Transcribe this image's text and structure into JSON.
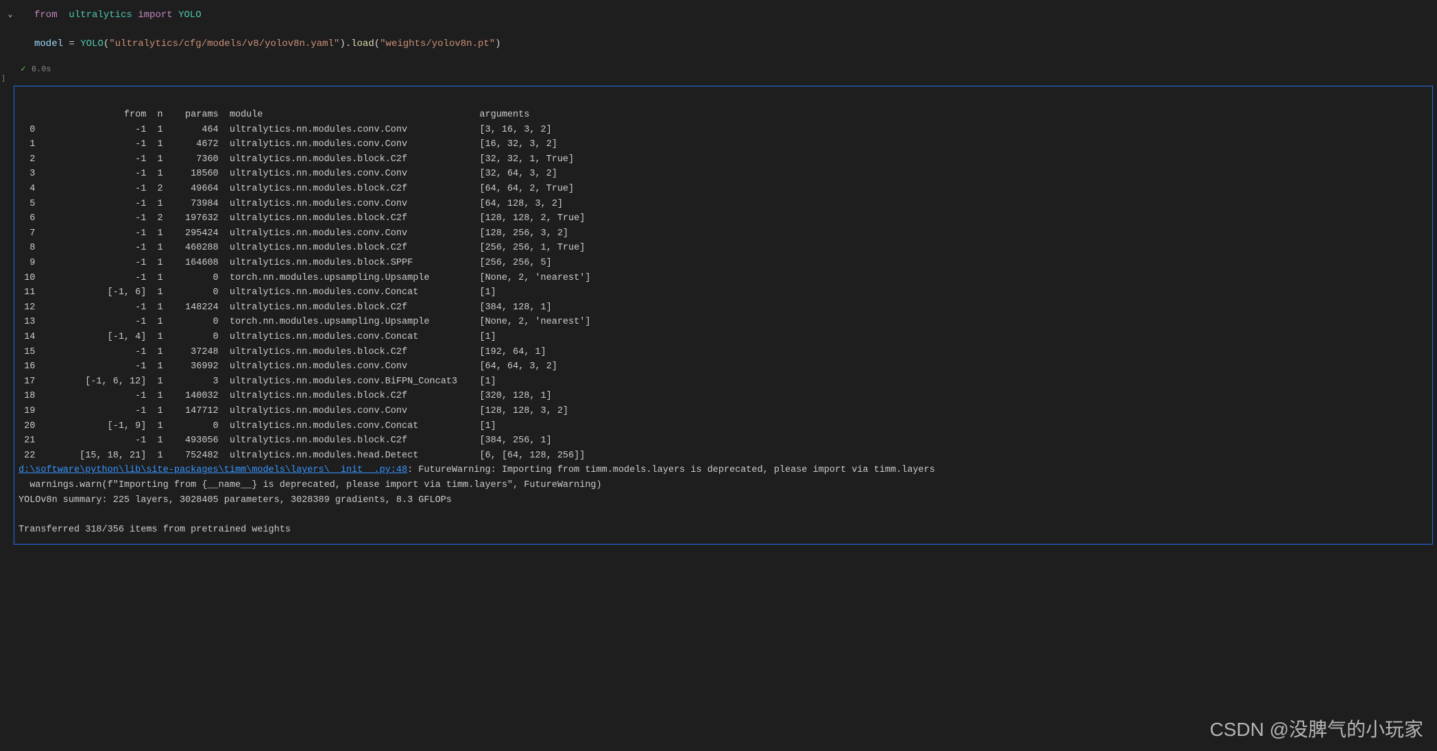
{
  "code": {
    "line1": {
      "from": "from",
      "pkg": "ultralytics",
      "import": "import",
      "cls": "YOLO"
    },
    "line2": {
      "var": "model",
      "eq": " = ",
      "cls": "YOLO",
      "arg1": "\"ultralytics/cfg/models/v8/yolov8n.yaml\"",
      "dot": ".",
      "method": "load",
      "arg2": "\"weights/yolov8n.pt\""
    }
  },
  "exec": {
    "time": "6.0s"
  },
  "cell_marker": "]",
  "output": {
    "header": "                   from  n    params  module                                       arguments",
    "rows": [
      "  0                  -1  1       464  ultralytics.nn.modules.conv.Conv             [3, 16, 3, 2]",
      "  1                  -1  1      4672  ultralytics.nn.modules.conv.Conv             [16, 32, 3, 2]",
      "  2                  -1  1      7360  ultralytics.nn.modules.block.C2f             [32, 32, 1, True]",
      "  3                  -1  1     18560  ultralytics.nn.modules.conv.Conv             [32, 64, 3, 2]",
      "  4                  -1  2     49664  ultralytics.nn.modules.block.C2f             [64, 64, 2, True]",
      "  5                  -1  1     73984  ultralytics.nn.modules.conv.Conv             [64, 128, 3, 2]",
      "  6                  -1  2    197632  ultralytics.nn.modules.block.C2f             [128, 128, 2, True]",
      "  7                  -1  1    295424  ultralytics.nn.modules.conv.Conv             [128, 256, 3, 2]",
      "  8                  -1  1    460288  ultralytics.nn.modules.block.C2f             [256, 256, 1, True]",
      "  9                  -1  1    164608  ultralytics.nn.modules.block.SPPF            [256, 256, 5]",
      " 10                  -1  1         0  torch.nn.modules.upsampling.Upsample         [None, 2, 'nearest']",
      " 11             [-1, 6]  1         0  ultralytics.nn.modules.conv.Concat           [1]",
      " 12                  -1  1    148224  ultralytics.nn.modules.block.C2f             [384, 128, 1]",
      " 13                  -1  1         0  torch.nn.modules.upsampling.Upsample         [None, 2, 'nearest']",
      " 14             [-1, 4]  1         0  ultralytics.nn.modules.conv.Concat           [1]",
      " 15                  -1  1     37248  ultralytics.nn.modules.block.C2f             [192, 64, 1]",
      " 16                  -1  1     36992  ultralytics.nn.modules.conv.Conv             [64, 64, 3, 2]",
      " 17         [-1, 6, 12]  1         3  ultralytics.nn.modules.conv.BiFPN_Concat3    [1]",
      " 18                  -1  1    140032  ultralytics.nn.modules.block.C2f             [320, 128, 1]",
      " 19                  -1  1    147712  ultralytics.nn.modules.conv.Conv             [128, 128, 3, 2]",
      " 20             [-1, 9]  1         0  ultralytics.nn.modules.conv.Concat           [1]",
      " 21                  -1  1    493056  ultralytics.nn.modules.block.C2f             [384, 256, 1]",
      " 22        [15, 18, 21]  1    752482  ultralytics.nn.modules.head.Detect           [6, [64, 128, 256]]"
    ],
    "warning_link": "d:\\software\\python\\lib\\site-packages\\timm\\models\\layers\\__init__.py:48",
    "warning_rest": ": FutureWarning: Importing from timm.models.layers is deprecated, please import via timm.layers",
    "warning_line2": "  warnings.warn(f\"Importing from {__name__} is deprecated, please import via timm.layers\", FutureWarning)",
    "summary": "YOLOv8n summary: 225 layers, 3028405 parameters, 3028389 gradients, 8.3 GFLOPs",
    "transfer": "Transferred 318/356 items from pretrained weights"
  },
  "watermark": "CSDN @没脾气的小玩家"
}
